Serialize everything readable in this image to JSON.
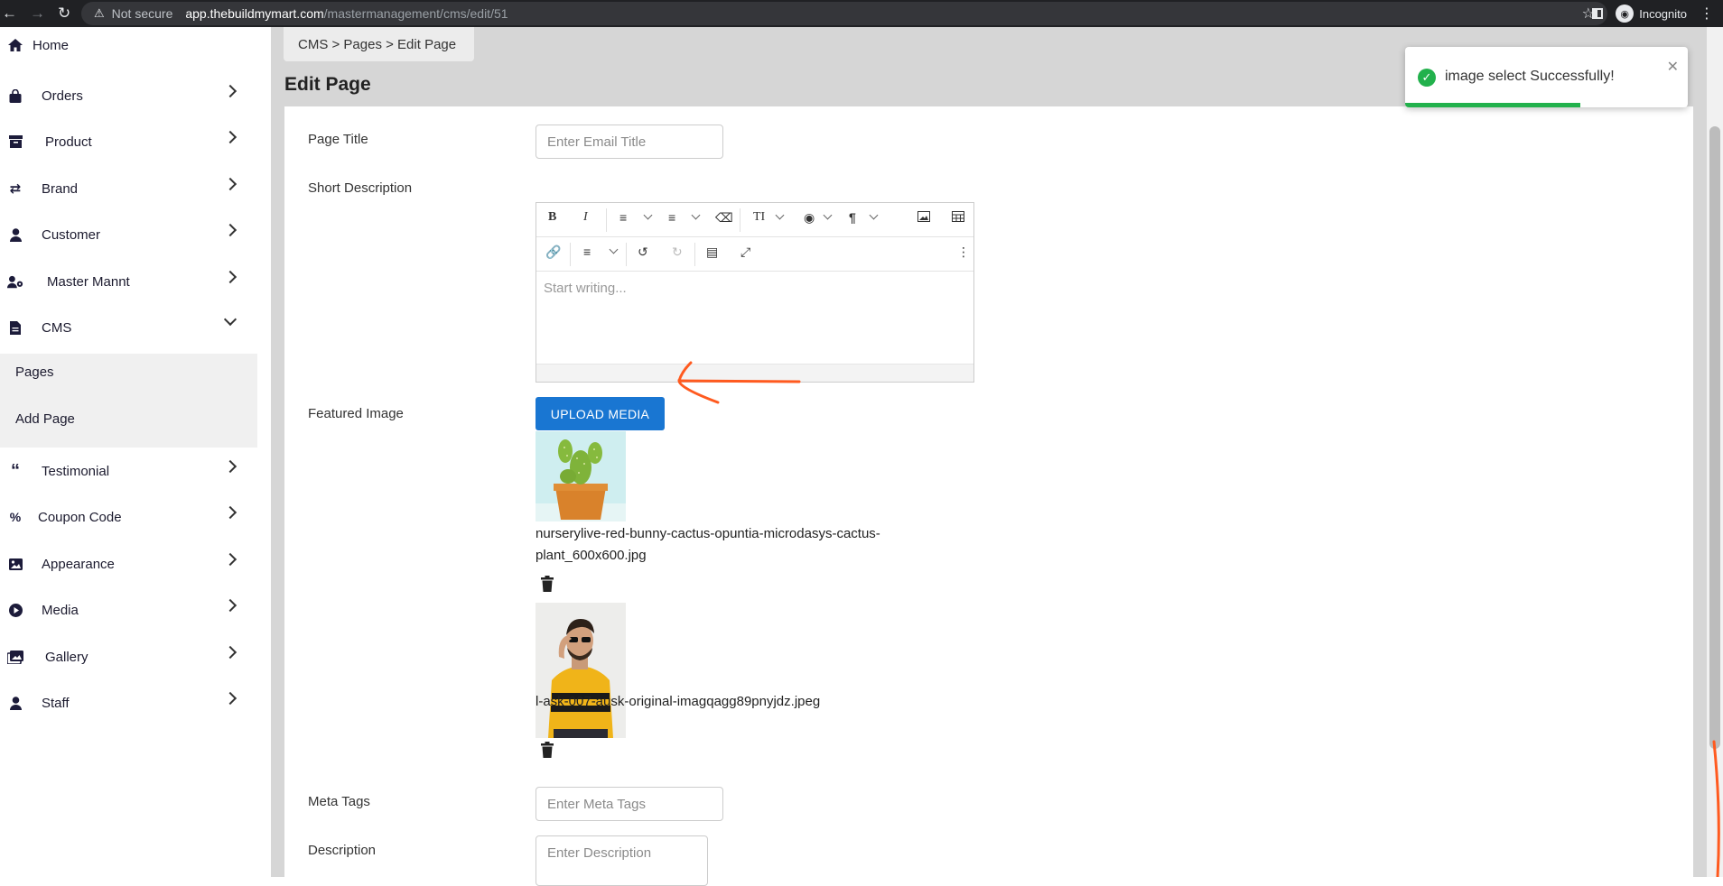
{
  "browser": {
    "security_label": "Not secure",
    "url_host": "app.thebuildmymart.com",
    "url_path": "/mastermanagement/cms/edit/51",
    "incognito_label": "Incognito"
  },
  "sidebar": {
    "items": [
      {
        "label": "Home",
        "icon": "home-icon"
      },
      {
        "label": "Orders",
        "icon": "bag-icon"
      },
      {
        "label": "Product",
        "icon": "archive-icon"
      },
      {
        "label": "Brand",
        "icon": "shuffle-icon"
      },
      {
        "label": "Customer",
        "icon": "user-icon"
      },
      {
        "label": "Master Mannt",
        "icon": "user-gear-icon"
      },
      {
        "label": "CMS",
        "icon": "file-icon"
      },
      {
        "label": "Testimonial",
        "icon": "quote-icon"
      },
      {
        "label": "Coupon Code",
        "icon": "percent-icon"
      },
      {
        "label": "Appearance",
        "icon": "image-icon"
      },
      {
        "label": "Media",
        "icon": "play-icon"
      },
      {
        "label": "Gallery",
        "icon": "images-icon"
      },
      {
        "label": "Staff",
        "icon": "user-icon"
      }
    ],
    "cms_sub": [
      {
        "label": "Pages"
      },
      {
        "label": "Add Page"
      }
    ]
  },
  "breadcrumb": "CMS > Pages > Edit Page",
  "page_title": "Edit Page",
  "form": {
    "page_title_label": "Page Title",
    "page_title_placeholder": "Enter Email Title",
    "short_desc_label": "Short Description",
    "editor_placeholder": "Start writing...",
    "featured_label": "Featured Image",
    "upload_label": "UPLOAD MEDIA",
    "images": [
      {
        "filename": "nurserylive-red-bunny-cactus-opuntia-microdasys-cactus-plant_600x600.jpg"
      },
      {
        "filename": "l-ask-007-ausk-original-imagqagg89pnyjdz.jpeg"
      }
    ],
    "meta_tags_label": "Meta Tags",
    "meta_tags_placeholder": "Enter Meta Tags",
    "description_label": "Description",
    "description_placeholder": "Enter Description"
  },
  "toast": {
    "message": "image select Successfully!",
    "progress": 0.62,
    "color": "#22b14c"
  },
  "colors": {
    "primary": "#1976d2",
    "annotation": "#ff5a1f"
  }
}
